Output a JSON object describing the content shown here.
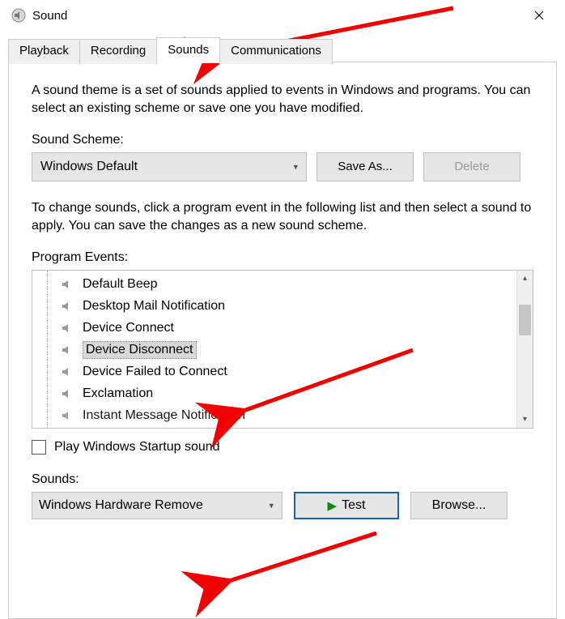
{
  "titlebar": {
    "title": "Sound"
  },
  "tabs": [
    {
      "label": "Playback",
      "active": false
    },
    {
      "label": "Recording",
      "active": false
    },
    {
      "label": "Sounds",
      "active": true
    },
    {
      "label": "Communications",
      "active": false
    }
  ],
  "description": "A sound theme is a set of sounds applied to events in Windows and programs.  You can select an existing scheme or save one you have modified.",
  "scheme": {
    "label": "Sound Scheme:",
    "value": "Windows Default",
    "save_as": "Save As...",
    "delete": "Delete"
  },
  "change_text": "To change sounds, click a program event in the following list and then select a sound to apply.  You can save the changes as a new sound scheme.",
  "events": {
    "label": "Program Events:",
    "items": [
      {
        "label": "Default Beep",
        "selected": false
      },
      {
        "label": "Desktop Mail Notification",
        "selected": false
      },
      {
        "label": "Device Connect",
        "selected": false
      },
      {
        "label": "Device Disconnect",
        "selected": true
      },
      {
        "label": "Device Failed to Connect",
        "selected": false
      },
      {
        "label": "Exclamation",
        "selected": false
      },
      {
        "label": "Instant Message Notification",
        "selected": false
      }
    ]
  },
  "startup": {
    "label": "Play Windows Startup sound",
    "checked": false
  },
  "sounds": {
    "label": "Sounds:",
    "value": "Windows Hardware Remove",
    "test": "Test",
    "browse": "Browse..."
  }
}
